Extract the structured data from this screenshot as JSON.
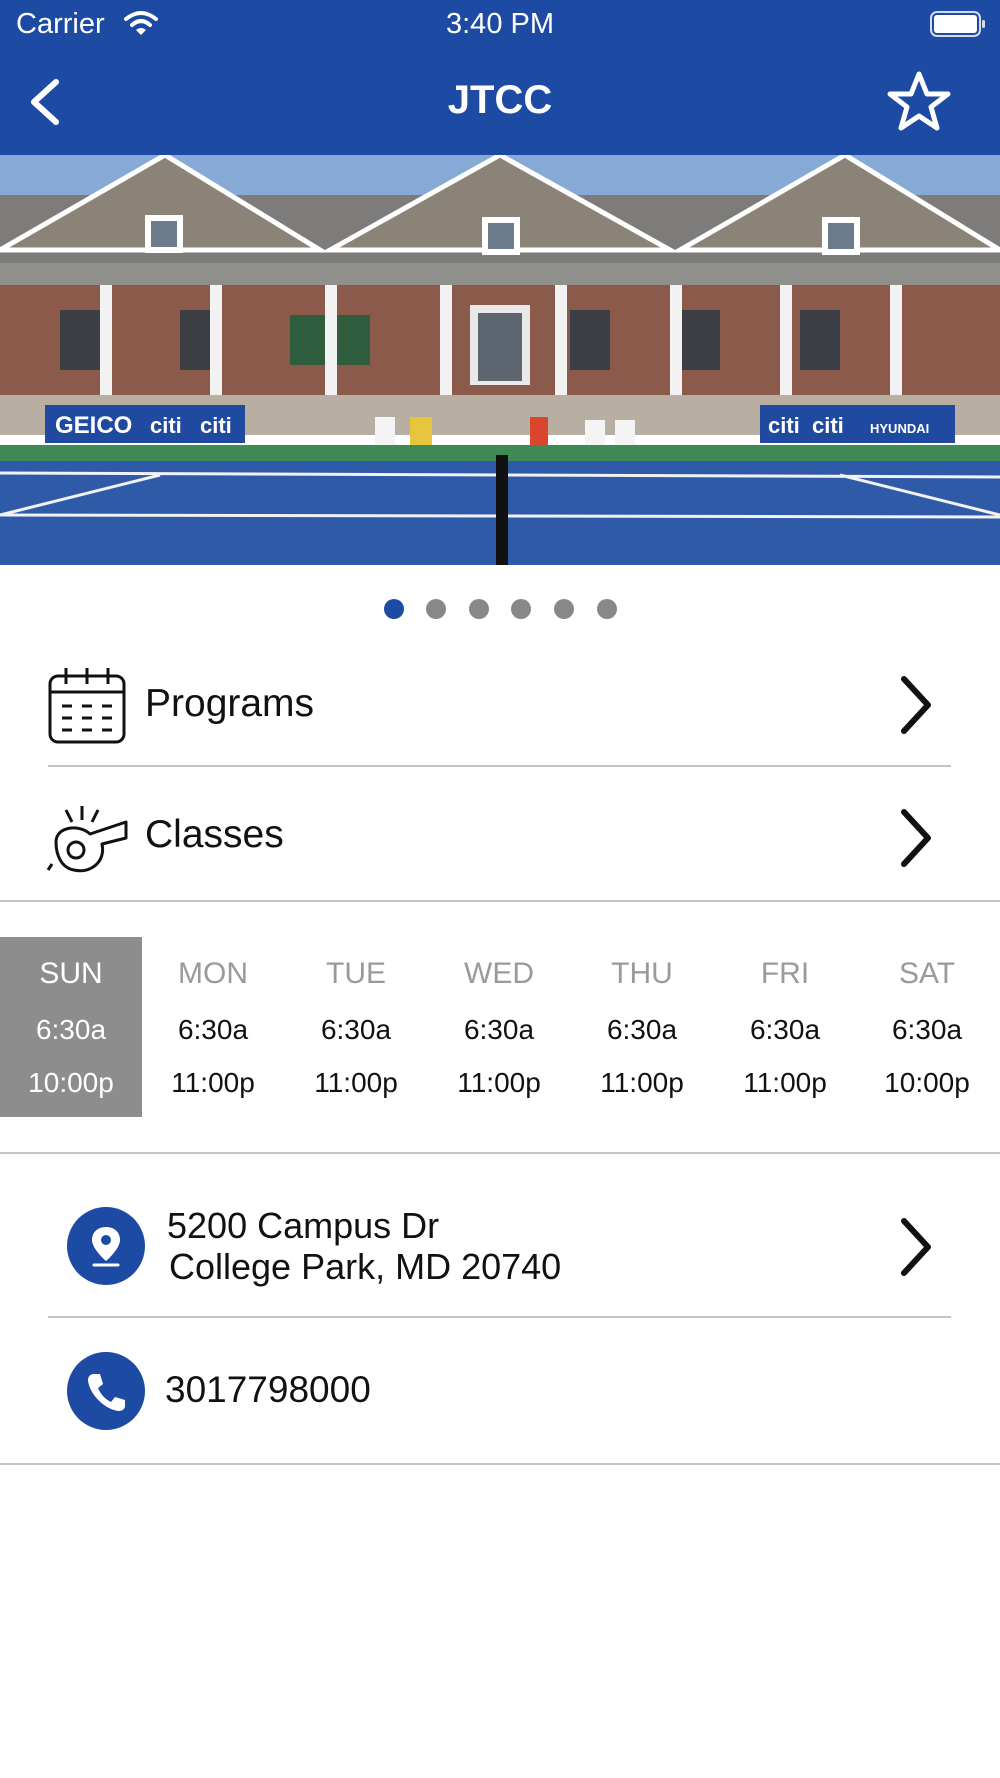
{
  "status_bar": {
    "carrier": "Carrier",
    "time": "3:40 PM"
  },
  "nav": {
    "title": "JTCC",
    "back_icon": "chevron-left-icon",
    "favorite_icon": "star-outline-icon"
  },
  "hero": {
    "page_count": 6,
    "active_page": 1,
    "banner_texts": [
      "GEICO",
      "citi",
      "citi",
      "citi",
      "citi",
      "HYUNDAI"
    ]
  },
  "menu": [
    {
      "label": "Programs",
      "icon": "calendar-icon"
    },
    {
      "label": "Classes",
      "icon": "whistle-icon"
    }
  ],
  "hours": [
    {
      "day": "SUN",
      "open": "6:30a",
      "close": "10:00p",
      "today": true
    },
    {
      "day": "MON",
      "open": "6:30a",
      "close": "11:00p"
    },
    {
      "day": "TUE",
      "open": "6:30a",
      "close": "11:00p"
    },
    {
      "day": "WED",
      "open": "6:30a",
      "close": "11:00p"
    },
    {
      "day": "THU",
      "open": "6:30a",
      "close": "11:00p"
    },
    {
      "day": "FRI",
      "open": "6:30a",
      "close": "11:00p"
    },
    {
      "day": "SAT",
      "open": "6:30a",
      "close": "10:00p"
    }
  ],
  "contact": {
    "address_line1": "5200 Campus Dr",
    "address_line2": "College Park, MD 20740",
    "phone": "3017798000"
  },
  "colors": {
    "brand": "#1d4ba3",
    "today_bg": "#8d8d8d",
    "separator": "#c4c4c4"
  }
}
